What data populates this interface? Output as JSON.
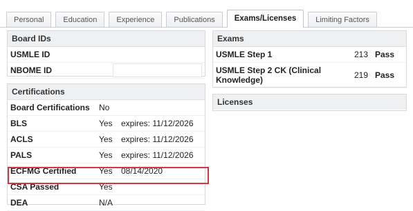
{
  "tabs": [
    "Personal",
    "Education",
    "Experience",
    "Publications",
    "Exams/Licenses",
    "Limiting Factors"
  ],
  "active_tab": "Exams/Licenses",
  "board_ids": {
    "title": "Board IDs",
    "rows": [
      {
        "label": "USMLE ID",
        "value": ""
      },
      {
        "label": "NBOME ID",
        "value": ""
      }
    ]
  },
  "certifications": {
    "title": "Certifications",
    "rows": [
      {
        "label": "Board Certifications",
        "status": "No",
        "detail": ""
      },
      {
        "label": "BLS",
        "status": "Yes",
        "detail": "expires: 11/12/2026"
      },
      {
        "label": "ACLS",
        "status": "Yes",
        "detail": "expires: 11/12/2026"
      },
      {
        "label": "PALS",
        "status": "Yes",
        "detail": "expires: 11/12/2026"
      },
      {
        "label": "ECFMG Certified",
        "status": "Yes",
        "detail": "08/14/2020"
      },
      {
        "label": "CSA Passed",
        "status": "Yes",
        "detail": ""
      },
      {
        "label": "DEA",
        "status": "N/A",
        "detail": ""
      }
    ]
  },
  "exams": {
    "title": "Exams",
    "rows": [
      {
        "name": "USMLE Step 1",
        "score": "213",
        "result": "Pass"
      },
      {
        "name": "USMLE Step 2 CK (Clinical Knowledge)",
        "score": "219",
        "result": "Pass"
      }
    ]
  },
  "licenses": {
    "title": "Licenses"
  },
  "highlight_color": "#d9343b"
}
